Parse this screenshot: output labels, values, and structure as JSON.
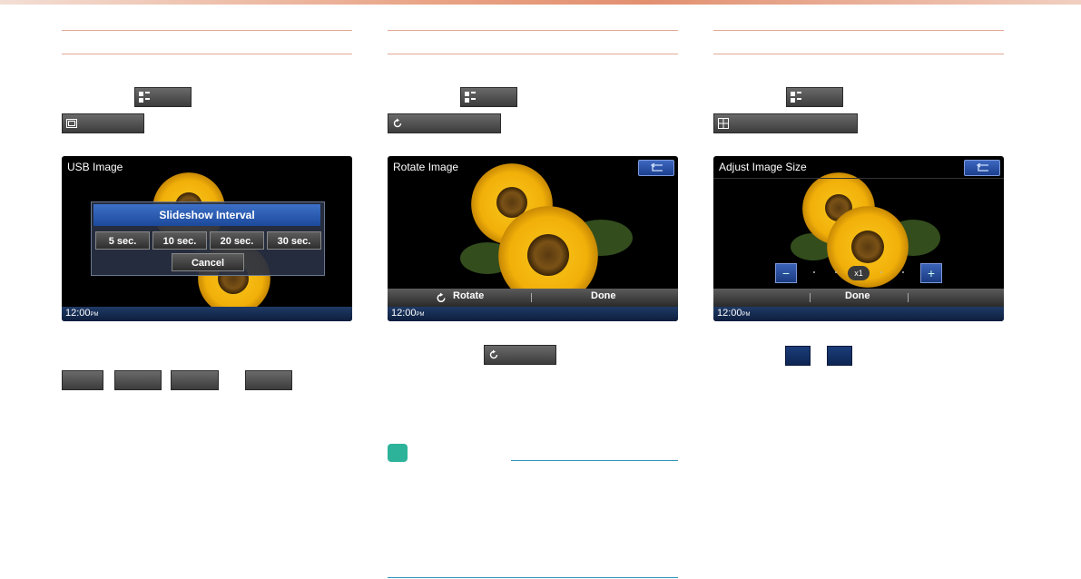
{
  "screens": {
    "usb_image": {
      "title": "USB Image",
      "status_time": "12:00",
      "status_ampm": "PM",
      "dialog_title": "Slideshow Interval",
      "options": [
        "5 sec.",
        "10 sec.",
        "20 sec.",
        "30 sec."
      ],
      "cancel_label": "Cancel"
    },
    "rotate_image": {
      "title": "Rotate Image",
      "status_time": "12:00",
      "status_ampm": "PM",
      "rotate_label": "Rotate",
      "done_label": "Done"
    },
    "adjust_image_size": {
      "title": "Adjust Image Size",
      "status_time": "12:00",
      "status_ampm": "PM",
      "zoom_value": "x1",
      "minus_label": "−",
      "plus_label": "+",
      "done_label": "Done"
    }
  },
  "colors": {
    "accent_line": "#e3a894",
    "note_badge": "#2db39a",
    "note_line": "#2f93b8",
    "title_bar_blue": "#1c4a9c"
  },
  "icons": {
    "menu": "grid-menu-icon",
    "image": "image-icon",
    "rotate": "rotate-icon",
    "resize": "resize-icon",
    "back": "back-arrow-icon"
  }
}
